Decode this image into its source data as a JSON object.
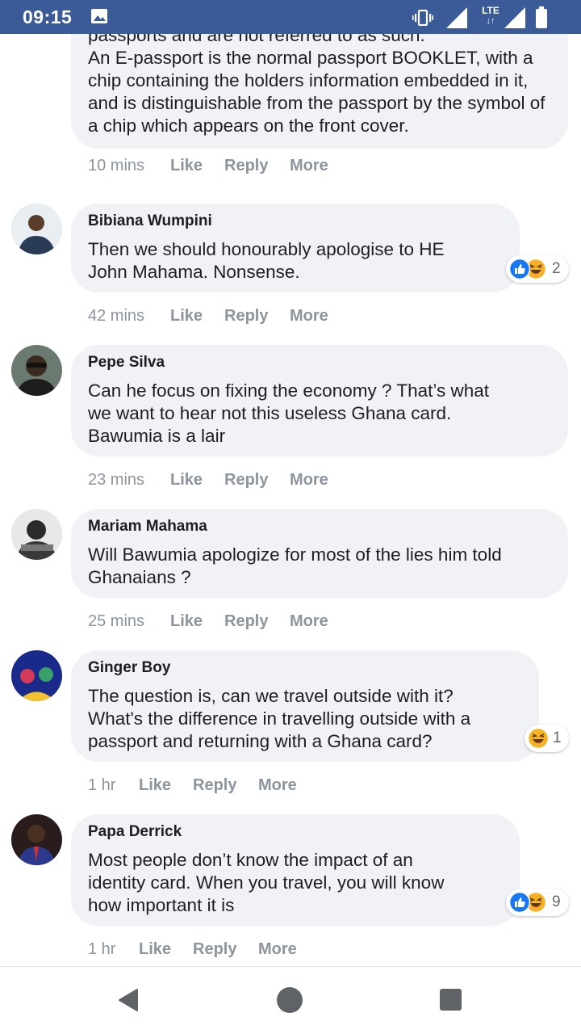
{
  "status_bar": {
    "time": "09:15",
    "network_label": "LTE",
    "icons": [
      "image-icon",
      "vibrate-icon",
      "signal-icon",
      "lte-icon",
      "signal-icon",
      "battery-icon"
    ]
  },
  "top_comment": {
    "text": "passports and are not referred to as such.\nAn E-passport is the normal passport BOOKLET, with a chip containing the holders information embedded in it, and is distinguishable from the passport by the symbol of a chip which appears on the front cover.",
    "time": "10 mins",
    "like": "Like",
    "reply": "Reply",
    "more": "More"
  },
  "comments": [
    {
      "author": "Bibiana Wumpini",
      "text": "Then we should honourably apologise to HE\nJohn Mahama. Nonsense.",
      "time": "42 mins",
      "like": "Like",
      "reply": "Reply",
      "more": "More",
      "reactions": [
        "like",
        "haha"
      ],
      "reaction_count": "2"
    },
    {
      "author": "Pepe Silva",
      "text": "Can he focus on fixing the economy ? That’s what\nwe want to hear not this useless Ghana card.\nBawumia is a lair",
      "time": "23 mins",
      "like": "Like",
      "reply": "Reply",
      "more": "More"
    },
    {
      "author": "Mariam Mahama",
      "text": "Will Bawumia apologize for most of the lies him told\nGhanaians ?",
      "time": "25 mins",
      "like": "Like",
      "reply": "Reply",
      "more": "More"
    },
    {
      "author": "Ginger Boy",
      "text": "The question is, can we travel outside with it?\nWhat's the difference in travelling outside with a\npassport and returning with a Ghana card?",
      "time": "1 hr",
      "like": "Like",
      "reply": "Reply",
      "more": "More",
      "reactions": [
        "haha"
      ],
      "reaction_count": "1"
    },
    {
      "author": "Papa Derrick",
      "text": "Most people don’t know the impact of an\nidentity card. When you travel, you will know\nhow important it is",
      "time": "1 hr",
      "like": "Like",
      "reply": "Reply",
      "more": "More",
      "reactions": [
        "like",
        "haha"
      ],
      "reaction_count": "9"
    }
  ],
  "colors": {
    "status_bar": "#3b5a98",
    "bubble": "#f0f2f5",
    "text": "#1c1e21",
    "meta": "#8d949e",
    "like_blue": "#1877f2",
    "haha_yellow": "#f7b125"
  },
  "nav": {
    "icons": [
      "back-icon",
      "home-icon",
      "recents-icon"
    ]
  }
}
